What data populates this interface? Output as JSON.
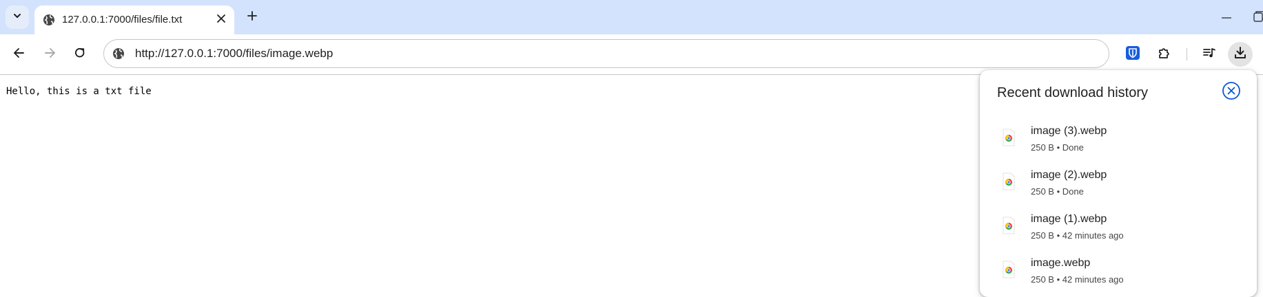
{
  "browser": {
    "tab": {
      "title": "127.0.0.1:7000/files/file.txt"
    },
    "address_bar": {
      "url": "http://127.0.0.1:7000/files/image.webp"
    }
  },
  "page": {
    "content_text": "Hello, this is a txt file"
  },
  "downloads_panel": {
    "title": "Recent download history",
    "items": [
      {
        "name": "image (3).webp",
        "status": "250 B • Done"
      },
      {
        "name": "image (2).webp",
        "status": "250 B • Done"
      },
      {
        "name": "image (1).webp",
        "status": "250 B • 42 minutes ago"
      },
      {
        "name": "image.webp",
        "status": "250 B • 42 minutes ago"
      }
    ]
  },
  "icons": {
    "tab_search": "chevron-down-icon",
    "tab_favicon": "globe-icon",
    "tab_close": "close-icon",
    "new_tab": "plus-icon",
    "back": "arrow-left-icon",
    "forward": "arrow-right-icon",
    "reload": "reload-icon",
    "site_info": "globe-icon",
    "bitwarden": "bitwarden-shield-icon",
    "extensions": "puzzle-icon",
    "media": "media-queue-icon",
    "downloads": "download-icon",
    "panel_close": "circle-close-icon",
    "file": "chrome-file-icon"
  },
  "colors": {
    "tabstrip_bg": "#d3e3fd",
    "accent_blue": "#0b57d0",
    "bitwarden_blue": "#175ddc",
    "text_primary": "#1f1f1f",
    "text_secondary": "#444746"
  }
}
